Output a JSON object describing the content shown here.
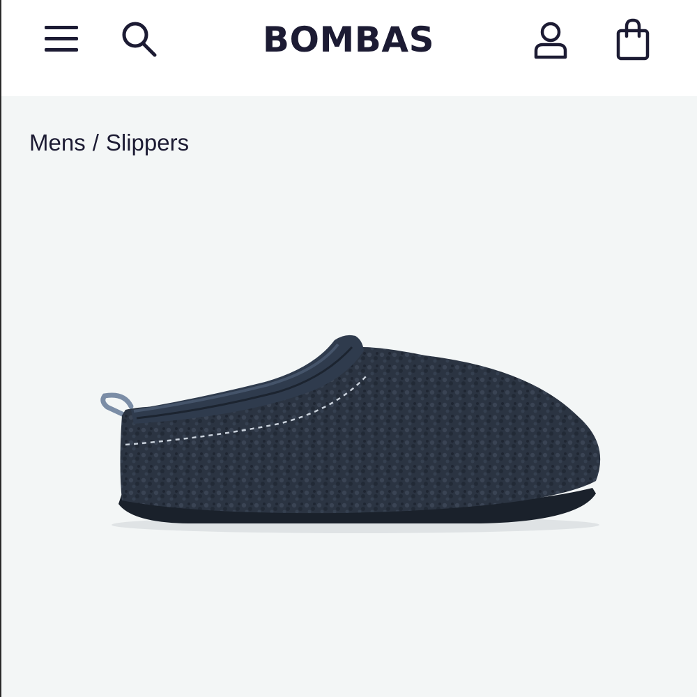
{
  "header": {
    "logo": "BOMBAS",
    "icons": [
      "menu-icon",
      "search-icon",
      "account-icon",
      "shopping-bag-icon"
    ]
  },
  "breadcrumb": {
    "items": [
      "Mens",
      "Slippers"
    ],
    "separator": "/"
  },
  "colors": {
    "brand": "#1c1b33",
    "page_background": "#f3f6f6",
    "header_background": "#ffffff",
    "slipper": "#2b3442"
  }
}
